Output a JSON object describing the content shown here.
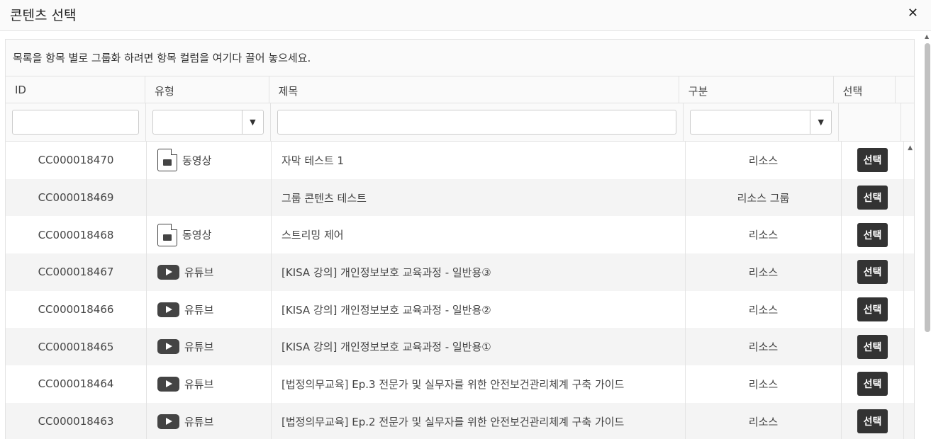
{
  "dialog": {
    "title": "콘텐츠 선택",
    "close_label": "✕"
  },
  "grid": {
    "group_panel_text": "목록을 항목 별로 그룹화 하려면 항목 컬럼을 여기다 끌어 놓으세요.",
    "columns": [
      "ID",
      "유형",
      "제목",
      "구분",
      "선택"
    ],
    "select_arrow": "▼",
    "rows": [
      {
        "id": "CC000018470",
        "type": "동영상",
        "type_icon": "video-file-icon",
        "title": "자막 테스트 1",
        "category": "리소스",
        "select": "선택"
      },
      {
        "id": "CC000018469",
        "type": "",
        "type_icon": "",
        "title": "그룹 콘텐츠 테스트",
        "category": "리소스 그룹",
        "select": "선택"
      },
      {
        "id": "CC000018468",
        "type": "동영상",
        "type_icon": "video-file-icon",
        "title": "스트리밍 제어",
        "category": "리소스",
        "select": "선택"
      },
      {
        "id": "CC000018467",
        "type": "유튜브",
        "type_icon": "youtube-icon",
        "title": "[KISA 강의] 개인정보보호 교육과정 - 일반용③",
        "category": "리소스",
        "select": "선택"
      },
      {
        "id": "CC000018466",
        "type": "유튜브",
        "type_icon": "youtube-icon",
        "title": "[KISA 강의] 개인정보보호 교육과정 - 일반용②",
        "category": "리소스",
        "select": "선택"
      },
      {
        "id": "CC000018465",
        "type": "유튜브",
        "type_icon": "youtube-icon",
        "title": "[KISA 강의] 개인정보보호 교육과정 - 일반용①",
        "category": "리소스",
        "select": "선택"
      },
      {
        "id": "CC000018464",
        "type": "유튜브",
        "type_icon": "youtube-icon",
        "title": "[법정의무교육] Ep.3 전문가 및 실무자를 위한 안전보건관리체계 구축 가이드",
        "category": "리소스",
        "select": "선택"
      },
      {
        "id": "CC000018463",
        "type": "유튜브",
        "type_icon": "youtube-icon",
        "title": "[법정의무교육] Ep.2 전문가 및 실무자를 위한 안전보건관리체계 구축 가이드",
        "category": "리소스",
        "select": "선택"
      }
    ]
  }
}
